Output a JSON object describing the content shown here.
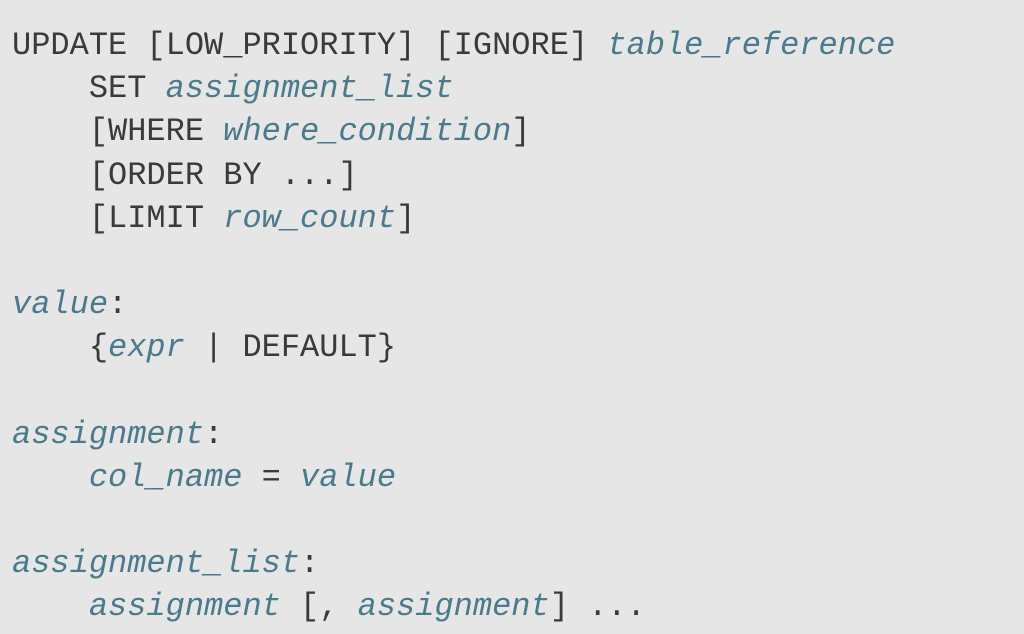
{
  "syntax": {
    "line1": {
      "kw1": "UPDATE [LOW_PRIORITY] [IGNORE] ",
      "ph1": "table_reference"
    },
    "line2": {
      "indent": "    ",
      "kw1": "SET ",
      "ph1": "assignment_list"
    },
    "line3": {
      "indent": "    ",
      "kw1": "[WHERE ",
      "ph1": "where_condition",
      "kw2": "]"
    },
    "line4": {
      "indent": "    ",
      "kw1": "[ORDER BY ...]"
    },
    "line5": {
      "indent": "    ",
      "kw1": "[LIMIT ",
      "ph1": "row_count",
      "kw2": "]"
    },
    "line6_blank": "",
    "line7": {
      "ph1": "value",
      "kw1": ":"
    },
    "line8": {
      "indent": "    ",
      "kw1": "{",
      "ph1": "expr",
      "kw2": " | DEFAULT}"
    },
    "line9_blank": "",
    "line10": {
      "ph1": "assignment",
      "kw1": ":"
    },
    "line11": {
      "indent": "    ",
      "ph1": "col_name",
      "kw1": " = ",
      "ph2": "value"
    },
    "line12_blank": "",
    "line13": {
      "ph1": "assignment_list",
      "kw1": ":"
    },
    "line14": {
      "indent": "    ",
      "ph1": "assignment",
      "kw1": " [, ",
      "ph2": "assignment",
      "kw2": "] ..."
    }
  }
}
